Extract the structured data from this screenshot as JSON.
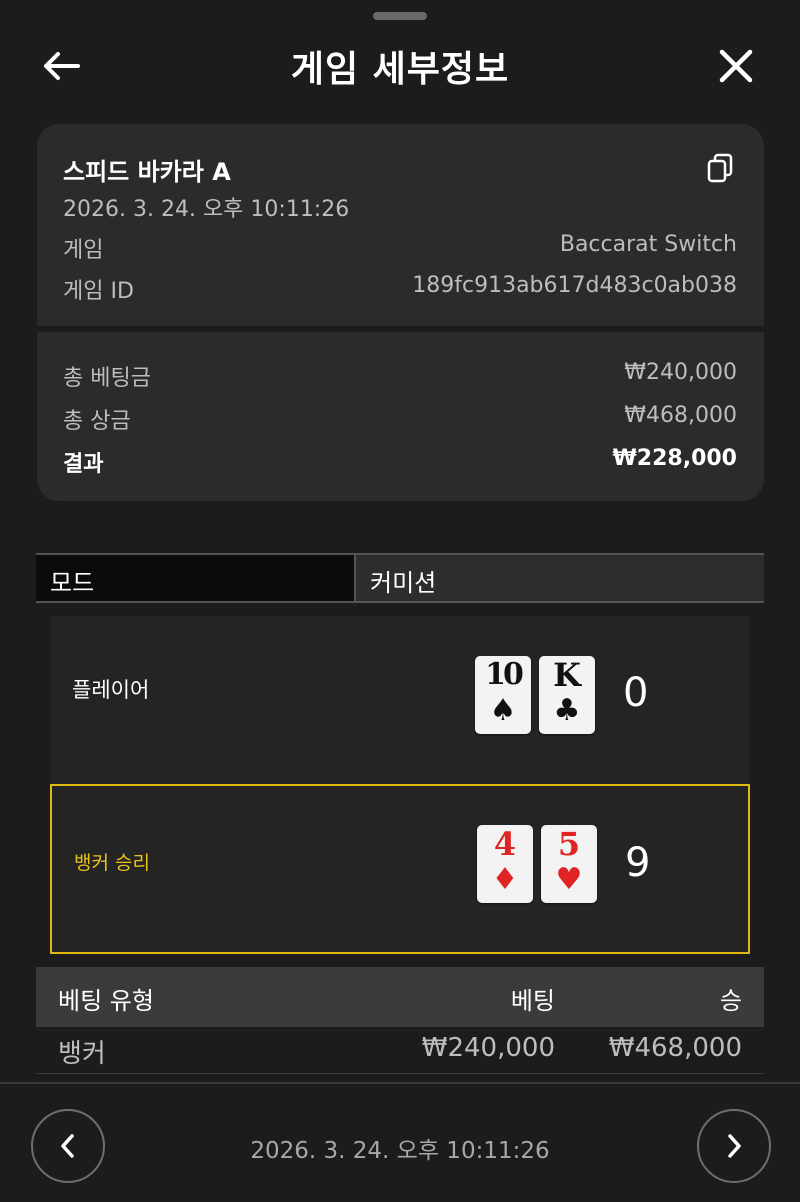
{
  "header": {
    "title": "게임 세부정보"
  },
  "game": {
    "name": "스피드 바카라 A",
    "datetime": "2026. 3. 24. 오후 10:11:26",
    "game_label": "게임",
    "game_value": "Baccarat Switch",
    "id_label": "게임 ID",
    "id_value": "189fc913ab617d483c0ab038"
  },
  "summary": {
    "total_bet_label": "총 베팅금",
    "total_bet_value": "₩240,000",
    "total_win_label": "총 상금",
    "total_win_value": "₩468,000",
    "result_label": "결과",
    "result_value": "₩228,000"
  },
  "mode": {
    "mode_label": "모드",
    "mode_value": "커미션"
  },
  "hands": {
    "player": {
      "label": "플레이어",
      "score": "0",
      "cards": [
        {
          "rank": "10",
          "suit": "♠"
        },
        {
          "rank": "K",
          "suit": "♣"
        }
      ]
    },
    "banker": {
      "label": "뱅커 승리",
      "score": "9",
      "cards": [
        {
          "rank": "4",
          "suit": "♦"
        },
        {
          "rank": "5",
          "suit": "♥"
        }
      ]
    }
  },
  "bets": {
    "headers": {
      "type": "베팅 유형",
      "bet": "베팅",
      "win": "승"
    },
    "rows": [
      {
        "type": "뱅커",
        "bet": "₩240,000",
        "win": "₩468,000"
      }
    ]
  },
  "footer": {
    "datetime": "2026. 3. 24. 오후 10:11:26"
  },
  "colors": {
    "winner_accent": "#e0b80f",
    "card_red": "#e02424",
    "background": "#1c1c1c"
  },
  "icons": {
    "back": "arrow-left-icon",
    "close": "close-icon",
    "copy": "copy-icon",
    "prev": "chevron-left-icon",
    "next": "chevron-right-icon"
  }
}
